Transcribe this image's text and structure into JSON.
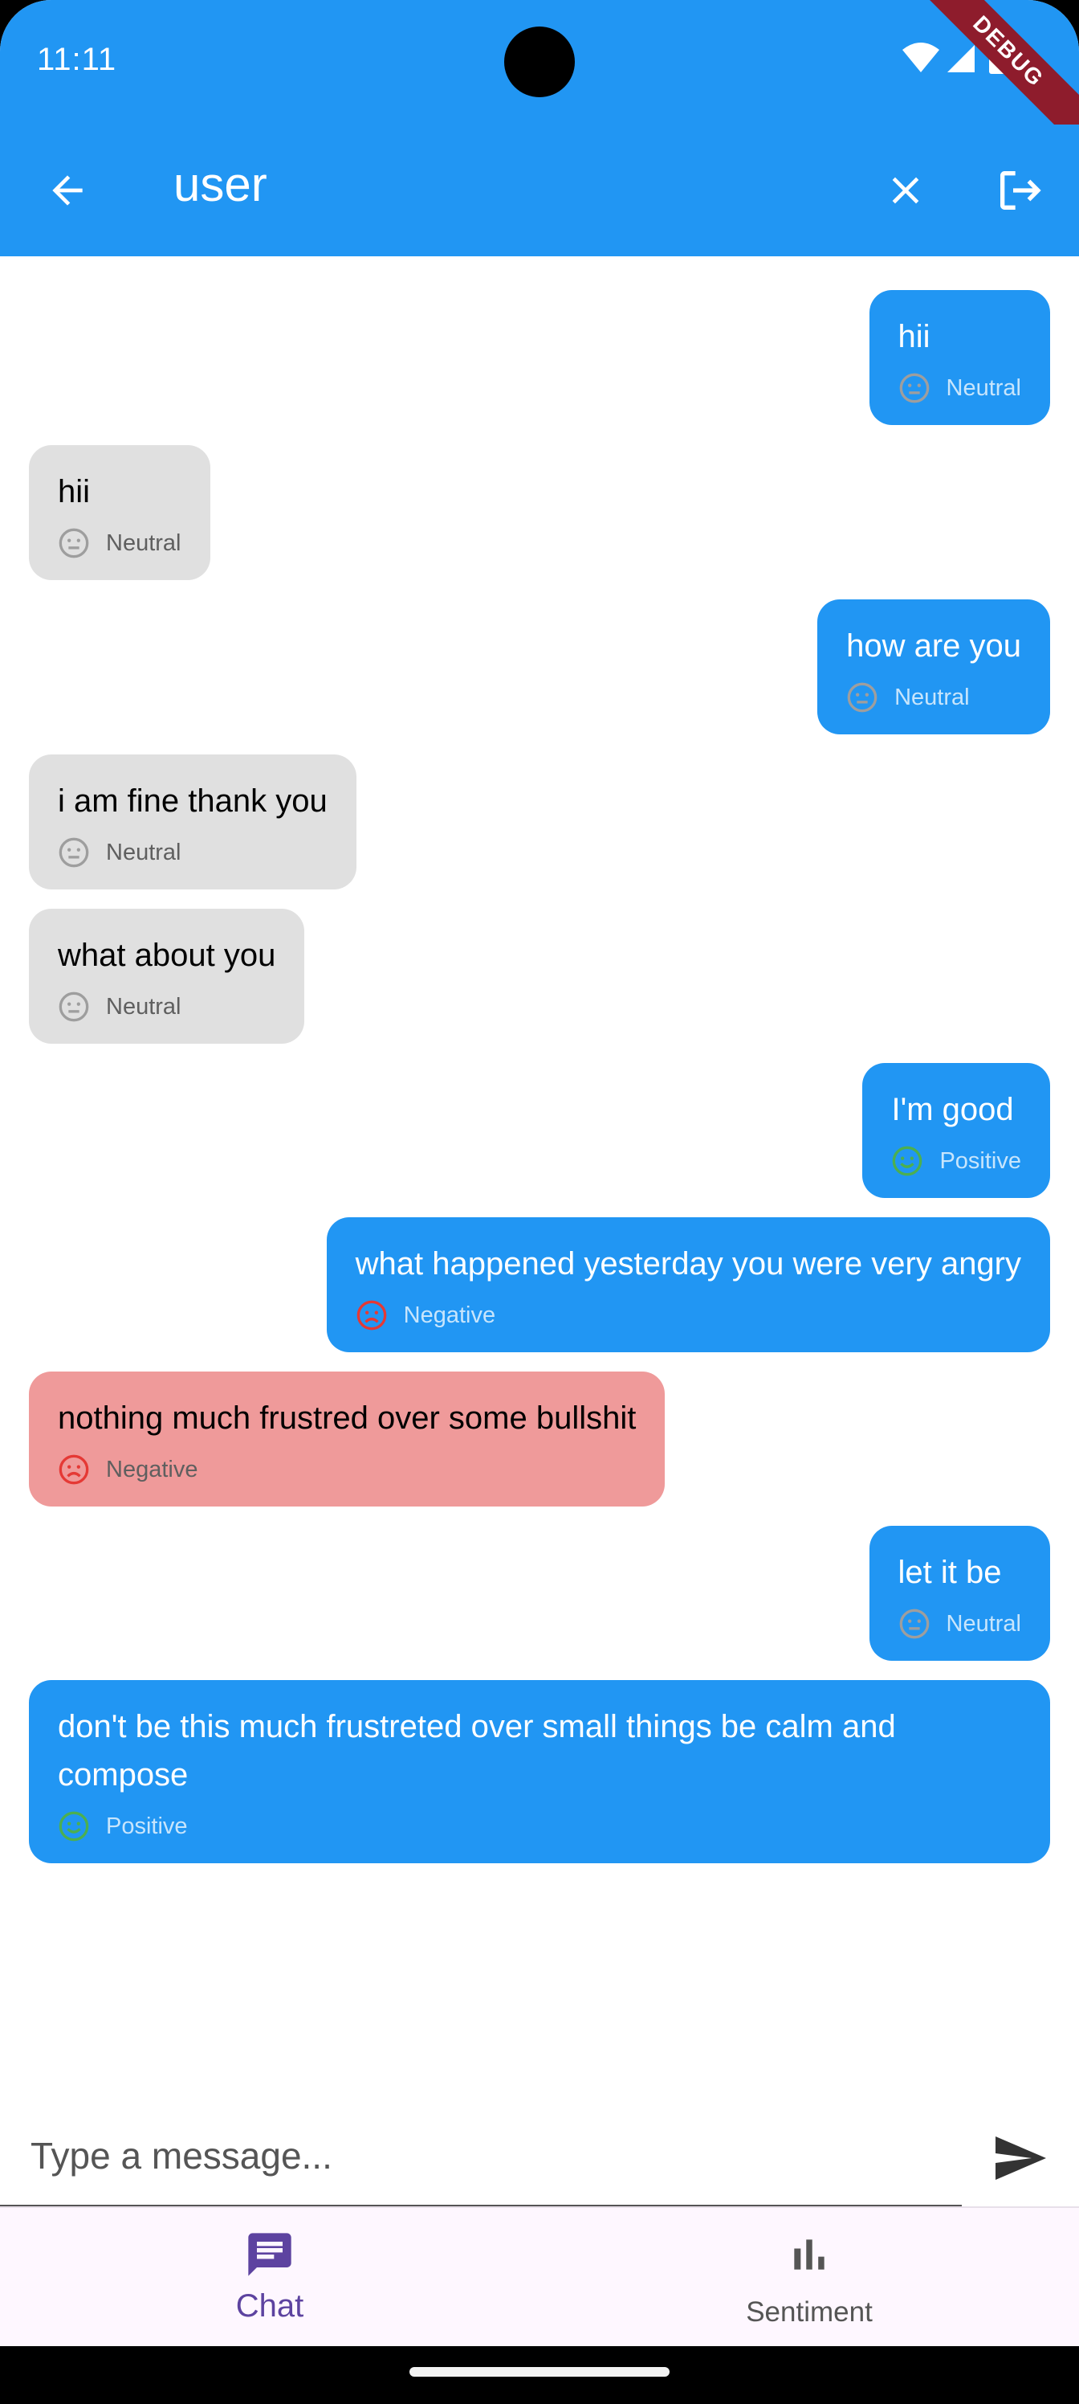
{
  "status_bar": {
    "time": "11:11",
    "debug_badge": "DEBUG"
  },
  "app_bar": {
    "title": "user",
    "back_icon": "arrow-left-icon",
    "clear_icon": "close-icon",
    "logout_icon": "logout-icon"
  },
  "colors": {
    "primary": "#2196F3",
    "bubble_other": "#E0E0E0",
    "bubble_negative": "#EF9A9A",
    "positive": "#4CAF50",
    "negative": "#E53935",
    "neutral": "#9E9E9E",
    "nav_active": "#5d43a0"
  },
  "messages": [
    {
      "sender": "me",
      "text": "hii",
      "sentiment": "Neutral"
    },
    {
      "sender": "other",
      "text": "hii",
      "sentiment": "Neutral"
    },
    {
      "sender": "me",
      "text": "how are you",
      "sentiment": "Neutral"
    },
    {
      "sender": "other",
      "text": "i am fine thank you",
      "sentiment": "Neutral"
    },
    {
      "sender": "other",
      "text": "what about you",
      "sentiment": "Neutral"
    },
    {
      "sender": "me",
      "text": "I'm good",
      "sentiment": "Positive"
    },
    {
      "sender": "me",
      "text": "what happened yesterday you were very angry",
      "sentiment": "Negative"
    },
    {
      "sender": "other",
      "text": "nothing much frustred over some bullshit",
      "sentiment": "Negative"
    },
    {
      "sender": "me",
      "text": "let it be",
      "sentiment": "Neutral"
    },
    {
      "sender": "me",
      "text": "don't be this much frustreted over small things be calm and compose",
      "sentiment": "Positive"
    }
  ],
  "composer": {
    "placeholder": "Type a message...",
    "value": "",
    "send_icon": "send-icon"
  },
  "bottom_nav": {
    "items": [
      {
        "label": "Chat",
        "icon": "chat-icon",
        "active": true
      },
      {
        "label": "Sentiment",
        "icon": "bar-chart-icon",
        "active": false
      }
    ]
  }
}
